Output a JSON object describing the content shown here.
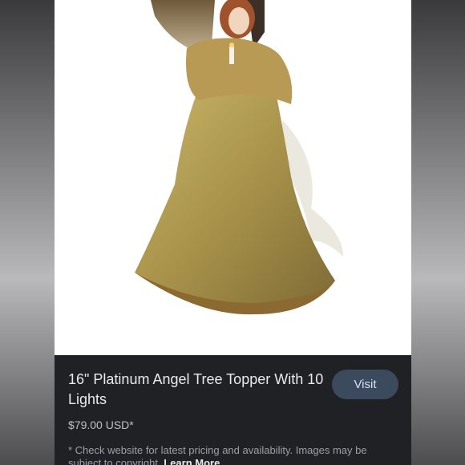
{
  "product": {
    "title": "16\" Platinum Angel Tree Topper With 10 Lights",
    "price": "$79.00 USD*",
    "image_subject": "angel-tree-topper"
  },
  "actions": {
    "visit_label": "Visit"
  },
  "disclaimer": {
    "text": "* Check website for latest pricing and availability. Images may be subject to copyright.",
    "learn_more_label": "Learn More"
  },
  "colors": {
    "panel_background": "#202124",
    "visit_button": "#3c4a5d",
    "visit_text": "#d2e3fc",
    "image_background": "#ffffff"
  }
}
